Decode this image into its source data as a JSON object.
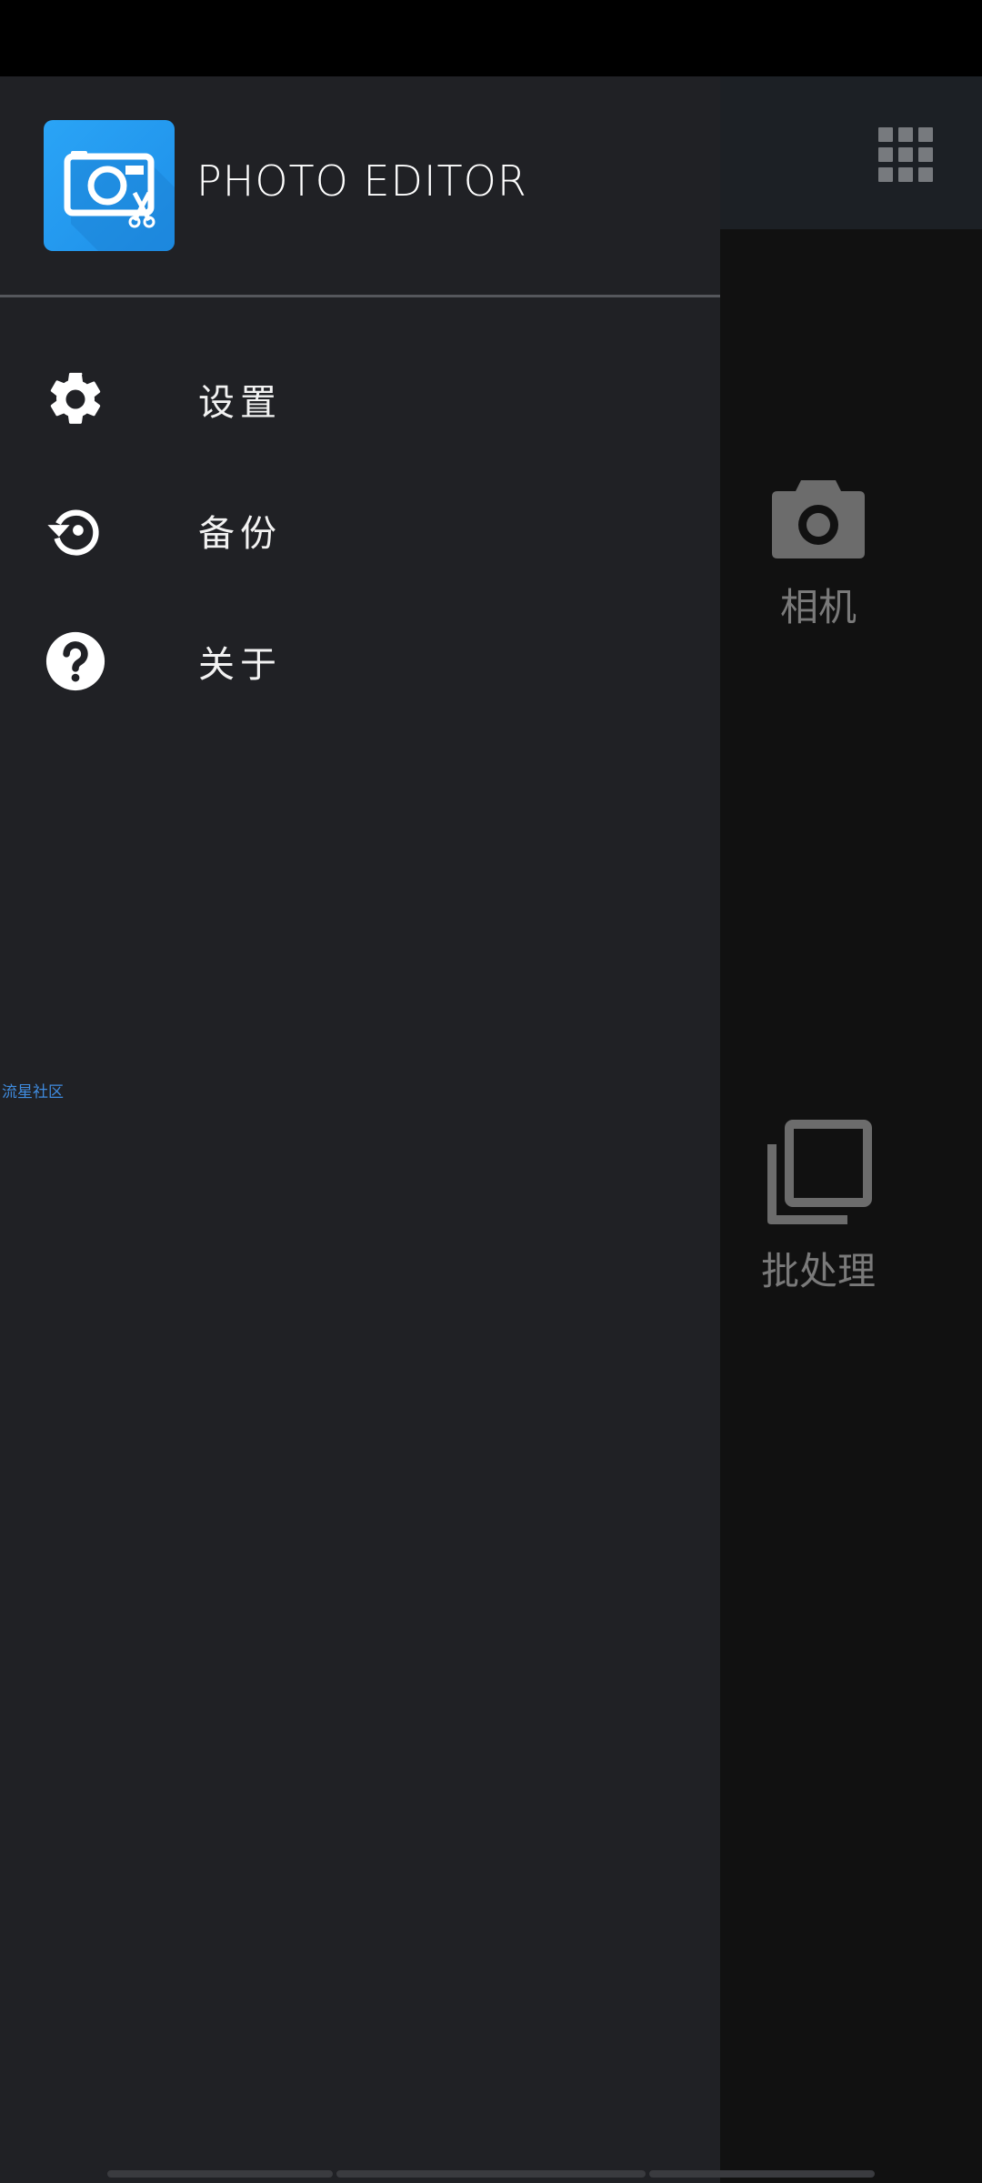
{
  "drawer": {
    "app_name": "PHOTO EDITOR",
    "menu": [
      {
        "label": "设置",
        "icon": "gear-icon"
      },
      {
        "label": "备份",
        "icon": "restore-icon"
      },
      {
        "label": "关于",
        "icon": "help-icon"
      }
    ],
    "watermark": "流星社区"
  },
  "main": {
    "toolbar_icon": "grid-icon",
    "tiles": [
      {
        "label": "相机",
        "icon": "camera-icon"
      },
      {
        "label": "批处理",
        "icon": "batch-icon"
      }
    ]
  },
  "colors": {
    "drawer_bg": "#202125",
    "accent": "#2196f3",
    "tile_label": "#7a7a7a"
  }
}
